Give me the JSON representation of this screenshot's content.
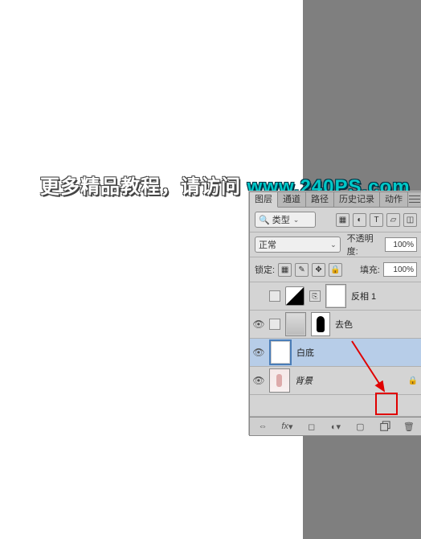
{
  "watermark": {
    "text1": "更多精品教程，请访问 ",
    "text2": "www.240PS.com"
  },
  "panel": {
    "tabs": [
      "图层",
      "通道",
      "路径",
      "历史记录",
      "动作"
    ],
    "activeTab": 0,
    "kindLabel": "类型",
    "blendMode": "正常",
    "opacityLabel": "不透明度:",
    "opacityValue": "100%",
    "lockLabel": "锁定:",
    "fillLabel": "填充:",
    "fillValue": "100%"
  },
  "layers": [
    {
      "name": "反相 1",
      "type": "adjustment",
      "visible": false
    },
    {
      "name": "去色",
      "type": "masked",
      "visible": true
    },
    {
      "name": "白底",
      "type": "normal",
      "visible": true,
      "selected": true
    },
    {
      "name": "背景",
      "type": "background",
      "visible": true,
      "locked": true
    }
  ],
  "footerIcons": [
    "link-icon",
    "fx-icon",
    "mask-icon",
    "adjust-icon",
    "group-icon",
    "new-layer-icon",
    "trash-icon"
  ]
}
